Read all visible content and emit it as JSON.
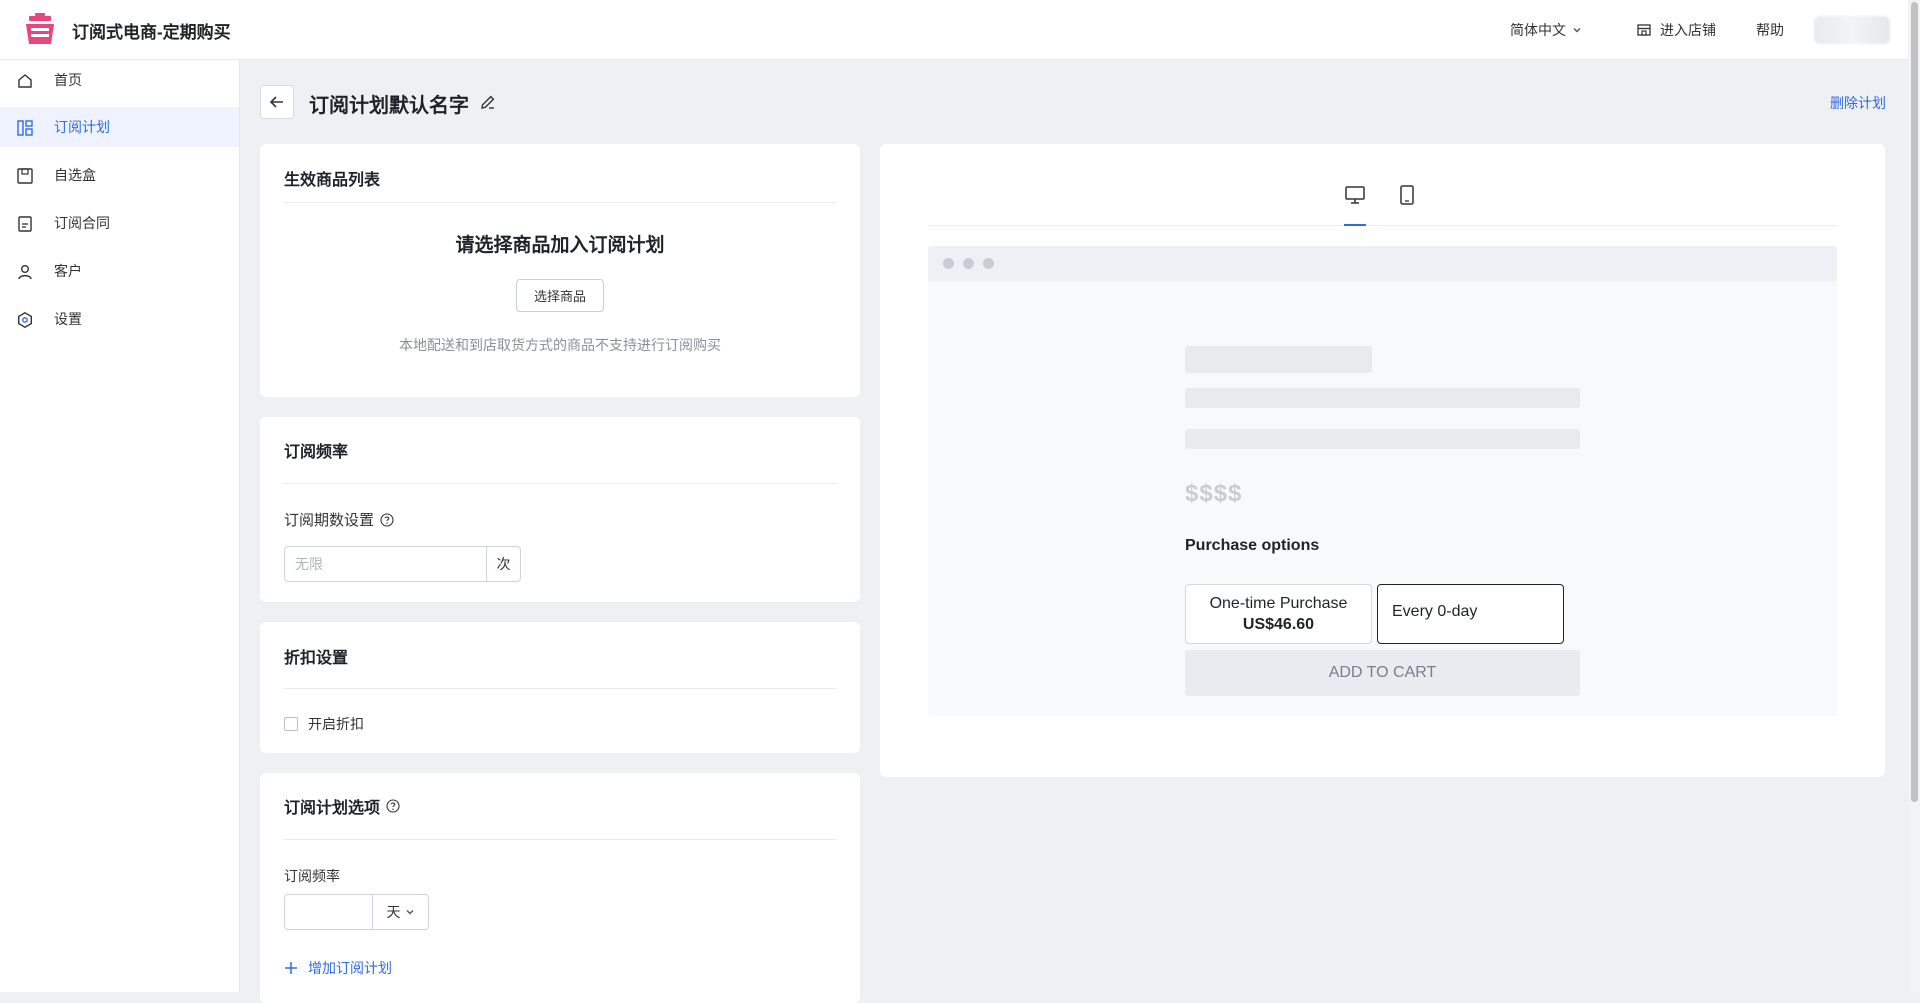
{
  "header": {
    "app_title": "订阅式电商-定期购买",
    "language": "简体中文",
    "store_link": "进入店铺",
    "help": "帮助"
  },
  "sidebar": {
    "items": [
      {
        "label": "首页",
        "icon": "home-icon"
      },
      {
        "label": "订阅计划",
        "icon": "plan-grid-icon",
        "active": true
      },
      {
        "label": "自选盒",
        "icon": "box-icon"
      },
      {
        "label": "订阅合同",
        "icon": "contract-icon"
      },
      {
        "label": "客户",
        "icon": "user-icon"
      },
      {
        "label": "设置",
        "icon": "settings-icon"
      }
    ]
  },
  "page": {
    "title": "订阅计划默认名字",
    "delete_label": "删除计划"
  },
  "products_card": {
    "title": "生效商品列表",
    "heading": "请选择商品加入订阅计划",
    "select_button": "选择商品",
    "hint": "本地配送和到店取货方式的商品不支持进行订阅购买"
  },
  "frequency_card": {
    "title": "订阅频率",
    "periods_label": "订阅期数设置",
    "periods_placeholder": "无限",
    "periods_unit": "次"
  },
  "discount_card": {
    "title": "折扣设置",
    "enable_label": "开启折扣",
    "enabled": false
  },
  "options_card": {
    "title": "订阅计划选项",
    "frequency_label": "订阅频率",
    "frequency_value": "",
    "frequency_unit": "天",
    "add_label": "增加订阅计划"
  },
  "preview": {
    "active_tab": "desktop",
    "price_placeholder": "$$$$",
    "purchase_options_label": "Purchase options",
    "one_time_label": "One-time Purchase",
    "one_time_price": "US$46.60",
    "subscription_option": "Every 0-day",
    "add_to_cart": "ADD TO CART"
  },
  "colors": {
    "accent": "#2e6be6",
    "brand": "#e8467c"
  }
}
